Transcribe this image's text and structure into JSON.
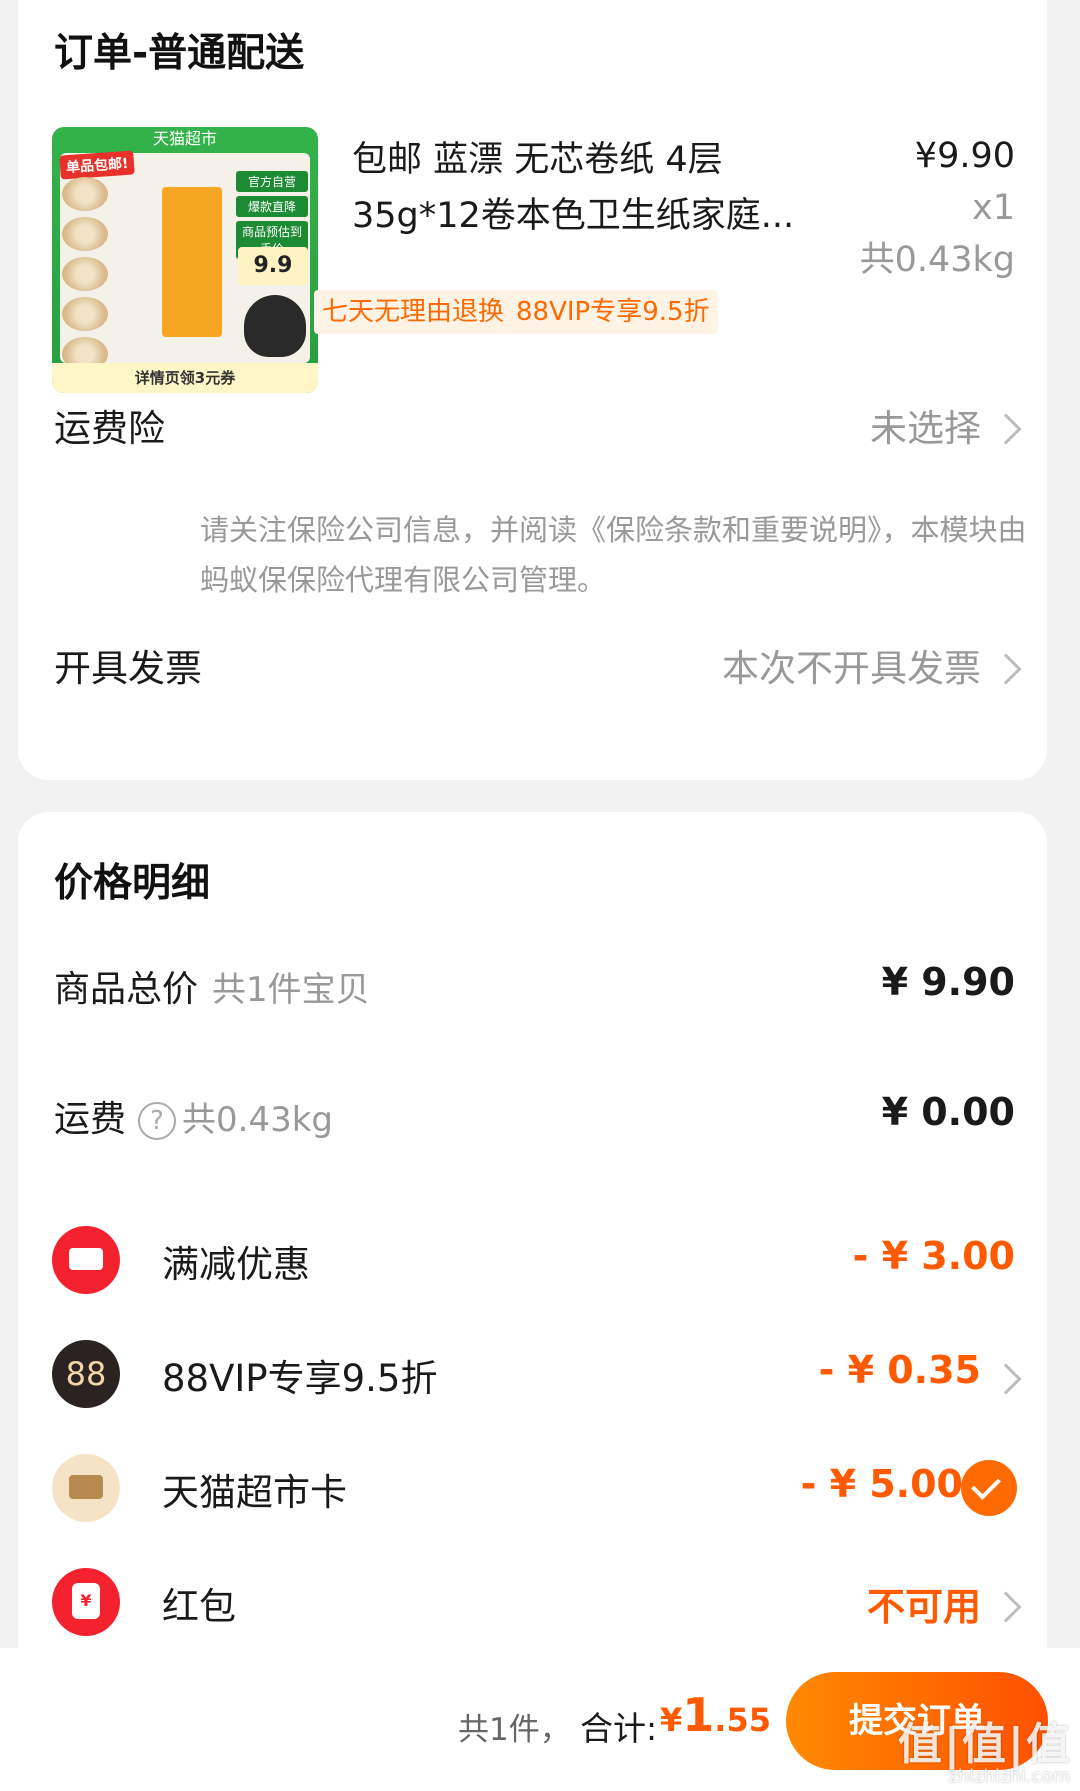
{
  "order": {
    "title": "订单-普通配送",
    "product": {
      "image": {
        "top_label": "天猫超市",
        "badge": "单品包邮!",
        "side_labels": [
          "官方自营",
          "爆款直降",
          "商品预估到手价"
        ],
        "price_tag": "9.9",
        "bottom_label": "详情页领3元券"
      },
      "title_line1": "包邮 蓝漂 无芯卷纸 4层",
      "title_line2": "35g*12卷本色卫生纸家庭...",
      "price": "¥9.90",
      "qty": "x1",
      "weight": "共0.43kg",
      "tags": [
        "七天无理由退换",
        "88VIP专享9.5折"
      ]
    },
    "shipping_insurance": {
      "label": "运费险",
      "value": "未选择",
      "note": "请关注保险公司信息，并阅读《保险条款和重要说明》，本模块由蚂蚁保保险代理有限公司管理。"
    },
    "invoice": {
      "label": "开具发票",
      "value": "本次不开具发票"
    }
  },
  "price_detail": {
    "title": "价格明细",
    "goods_total": {
      "label": "商品总价",
      "sub": "共1件宝贝",
      "amount": "¥ 9.90"
    },
    "shipping": {
      "label": "运费",
      "help": "?",
      "sub": "共0.43kg",
      "amount": "¥ 0.00"
    },
    "discounts": [
      {
        "label": "满减优惠",
        "amount": "- ¥ 3.00",
        "icon": "ticket-icon"
      },
      {
        "label": "88VIP专享9.5折",
        "amount": "- ¥ 0.35",
        "icon_text": "88",
        "icon": "vip88-icon"
      },
      {
        "label": "天猫超市卡",
        "amount": "- ¥ 5.00",
        "icon": "card-icon"
      },
      {
        "label": "红包",
        "amount": "不可用",
        "icon": "red-packet-icon",
        "icon_text": "¥"
      }
    ]
  },
  "bottom_bar": {
    "count": "共1件，",
    "total_label": "合计:",
    "total_yen": "¥",
    "total_int": "1",
    "total_dec": ".55",
    "submit": "提交订单",
    "watermark": "值|值|值",
    "watermark_sub": "zhizhizhi.com"
  },
  "colors": {
    "accent": "#ff5a00",
    "background": "#f2f2f2",
    "muted": "#999999"
  }
}
